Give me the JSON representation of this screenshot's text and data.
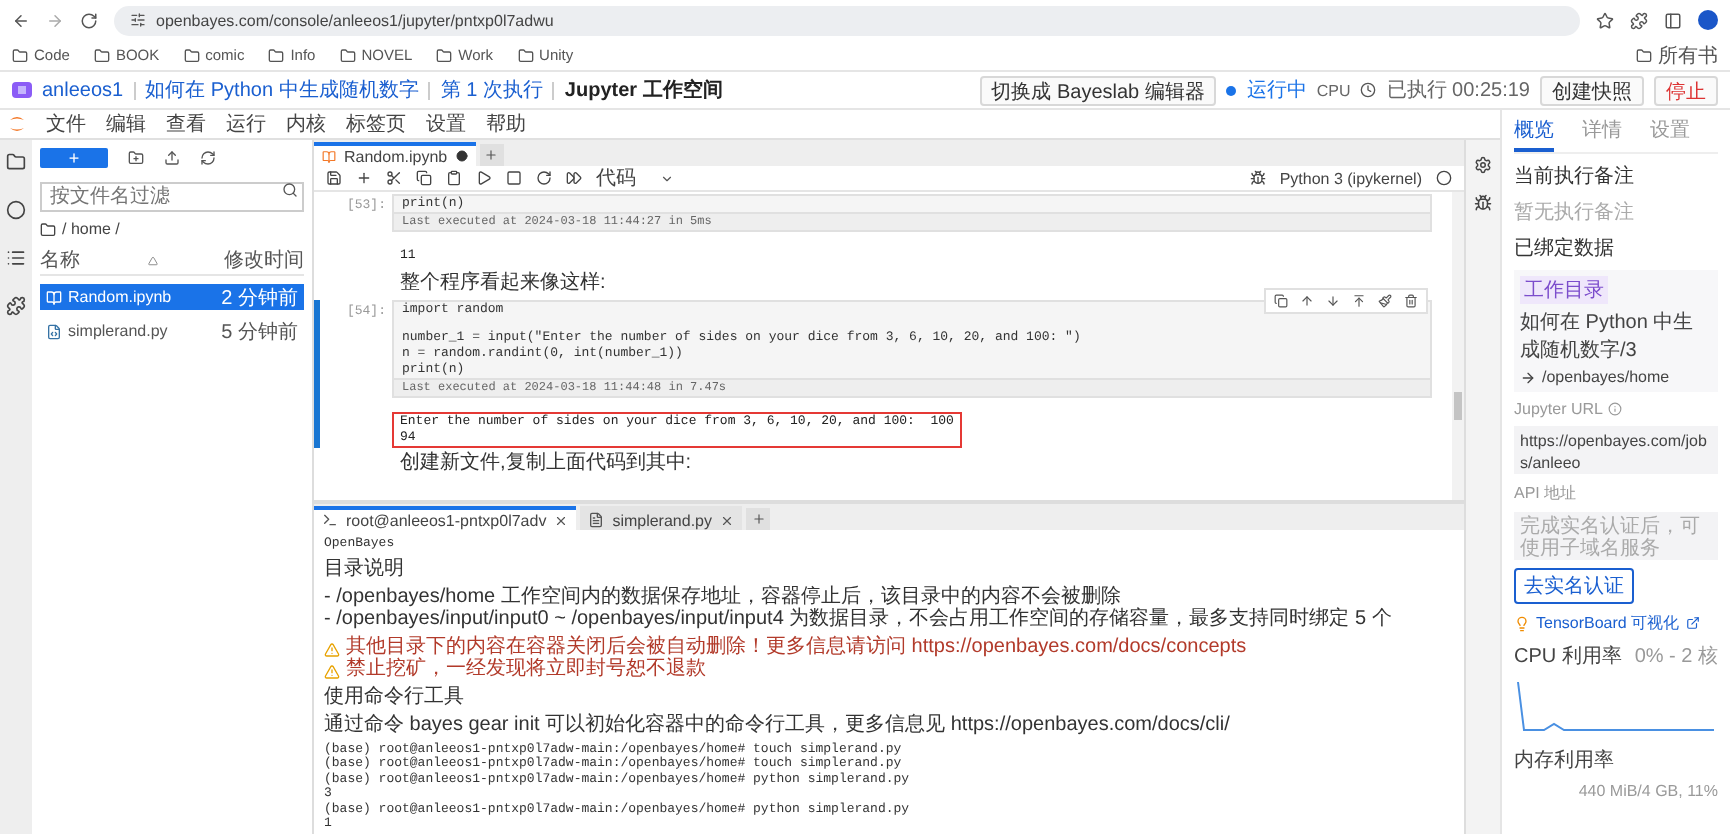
{
  "browser": {
    "url": "openbayes.com/console/anleeos1/jupyter/pntxp0l7adwu",
    "bookmarks": [
      "Code",
      "BOOK",
      "comic",
      "Info",
      "NOVEL",
      "Work",
      "Unity"
    ],
    "bookmarks_more": "所有书"
  },
  "header": {
    "breadcrumb": [
      "anleeos1",
      "如何在 Python 中生成随机数字",
      "第 1 次执行",
      "Jupyter 工作空间"
    ],
    "switch_button": "切换成 Bayeslab 编辑器",
    "status": "运行中",
    "cpu": "CPU",
    "elapsed": "已执行 00:25:19",
    "snapshot_button": "创建快照",
    "stop_button": "停止"
  },
  "menu": [
    "文件",
    "编辑",
    "查看",
    "运行",
    "内核",
    "标签页",
    "设置",
    "帮助"
  ],
  "file_browser": {
    "new_button": "+",
    "filter_placeholder": "按文件名过滤",
    "path": "/ home /",
    "columns": [
      "名称",
      "修改时间"
    ],
    "files": [
      {
        "name": "Random.ipynb",
        "modified": "2 分钟前",
        "selected": true,
        "kind": "notebook"
      },
      {
        "name": "simplerand.py",
        "modified": "5 分钟前",
        "selected": false,
        "kind": "python"
      }
    ]
  },
  "notebook": {
    "tab": "Random.ipynb",
    "cell_type": "代码",
    "kernel": "Python 3 (ipykernel)",
    "cells": [
      {
        "kind": "code",
        "prompt": "[53]:",
        "code": [
          {
            "text": "print(n)"
          }
        ],
        "footer": "Last executed at 2024-03-18 11:44:27 in 5ms",
        "output": [
          "11"
        ]
      },
      {
        "kind": "markdown",
        "text": "整个程序看起来像这样:"
      },
      {
        "kind": "code",
        "prompt": "[54]:",
        "active": true,
        "highlighted": true,
        "code": [
          {
            "text": "import random"
          },
          {
            "text": "number_1 = input(\"Enter the number of sides on your dice from 3, 6, 10, 20, and 100: \")",
            "gap_before": true
          },
          {
            "text": "n = random.randint(0, int(number_1))"
          },
          {
            "text": "print(n)"
          }
        ],
        "footer": "Last executed at 2024-03-18 11:44:48 in 7.47s",
        "output": [
          "Enter the number of sides on your dice from 3, 6, 10, 20, and 100:  100",
          "94"
        ]
      },
      {
        "kind": "markdown",
        "text": "创建新文件,复制上面代码到其中:"
      }
    ]
  },
  "terminal": {
    "tabs": [
      {
        "label": "root@anleeos1-pntxp0l7adv",
        "selected": true,
        "kind": "terminal"
      },
      {
        "label": "simplerand.py",
        "selected": false,
        "kind": "file"
      }
    ],
    "lines": [
      {
        "kind": "shell",
        "text": "OpenBayes"
      },
      {
        "kind": "info",
        "text": "目录说明",
        "gap_before": true
      },
      {
        "kind": "info",
        "text": "- /openbayes/home 工作空间内的数据保存地址，容器停止后，该目录中的内容不会被删除",
        "gap_before": true
      },
      {
        "kind": "info",
        "text": "- /openbayes/input/input0 ~ /openbayes/input/input4 为数据目录，不会占用工作空间的存储容量，最多支持同时绑定 5 个"
      },
      {
        "kind": "warning",
        "text": "其他目录下的内容在容器关闭后会被自动删除！更多信息请访问 https://openbayes.com/docs/concepts",
        "gap_before": true
      },
      {
        "kind": "warning",
        "text": "禁止挖矿，一经发现将立即封号恕不退款"
      },
      {
        "kind": "info",
        "text": "使用命令行工具",
        "gap_before": true
      },
      {
        "kind": "info",
        "text": "通过命令 bayes gear init 可以初始化容器中的命令行工具，更多信息见 https://openbayes.com/docs/cli/",
        "gap_before": true
      },
      {
        "kind": "shell",
        "text": "(base) root@anleeos1-pntxp0l7adw-main:/openbayes/home# touch simplerand.py",
        "gap_before": true
      },
      {
        "kind": "shell",
        "text": "(base) root@anleeos1-pntxp0l7adw-main:/openbayes/home# touch simplerand.py"
      },
      {
        "kind": "shell",
        "text": "(base) root@anleeos1-pntxp0l7adw-main:/openbayes/home# python simplerand.py"
      },
      {
        "kind": "shell",
        "text": "3"
      },
      {
        "kind": "shell",
        "text": "(base) root@anleeos1-pntxp0l7adw-main:/openbayes/home# python simplerand.py"
      },
      {
        "kind": "shell",
        "text": "1"
      }
    ]
  },
  "side_panel": {
    "tabs": [
      {
        "label": "概览",
        "selected": true
      },
      {
        "label": "详情",
        "selected": false
      },
      {
        "label": "设置",
        "selected": false
      }
    ],
    "note_title": "当前执行备注",
    "note": "暂无执行备注",
    "data_title": "已绑定数据",
    "binding": {
      "tag": "工作目录",
      "source": "如何在 Python 中生成随机数字/3",
      "target": "/openbayes/home"
    },
    "url_label": "Jupyter URL",
    "url_value": "https://openbayes.com/jobs/anleeo",
    "api_label": "API 地址",
    "api_placeholder": "完成实名认证后，可使用子域名服务",
    "verify_button": "去实名认证",
    "tensorboard": "TensorBoard 可视化",
    "cpu_label": "CPU 利用率",
    "cpu_range": "0% - 2 核",
    "memory_label": "内存利用率",
    "memory_value": "440 MiB/4 GB, 11%"
  }
}
